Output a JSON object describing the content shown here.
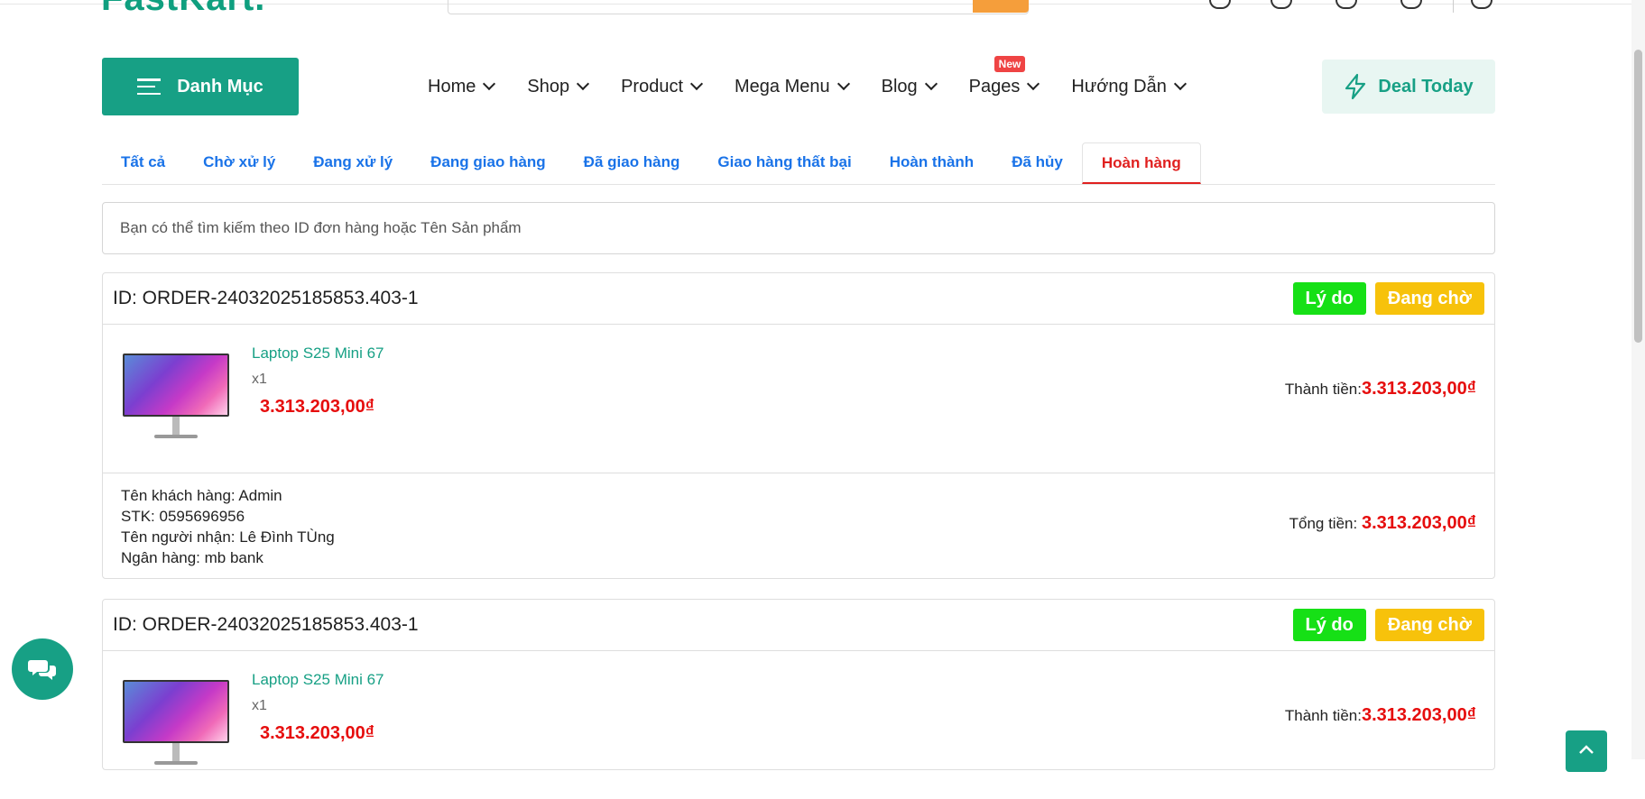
{
  "header": {
    "logo_text": "FastKart.",
    "brand_color": "#17a085"
  },
  "nav": {
    "menu_button": "Danh Mục",
    "items": [
      {
        "label": "Home"
      },
      {
        "label": "Shop"
      },
      {
        "label": "Product"
      },
      {
        "label": "Mega Menu"
      },
      {
        "label": "Blog"
      },
      {
        "label": "Pages",
        "badge": "New"
      },
      {
        "label": "Hướng Dẫn"
      }
    ],
    "deal_label": "Deal Today"
  },
  "tabs": [
    {
      "label": "Tất cả"
    },
    {
      "label": "Chờ xử lý"
    },
    {
      "label": "Đang xử lý"
    },
    {
      "label": "Đang giao hàng"
    },
    {
      "label": "Đã giao hàng"
    },
    {
      "label": "Giao hàng thất bại"
    },
    {
      "label": "Hoàn thành"
    },
    {
      "label": "Đã hủy"
    },
    {
      "label": "Hoàn hàng",
      "active": true
    }
  ],
  "search": {
    "placeholder": "Bạn có thể tìm kiếm theo ID đơn hàng hoặc Tên Sản phẩm"
  },
  "orders": [
    {
      "id_text": "ID: ORDER-24032025185853.403-1",
      "reason_label": "Lý do",
      "status_label": "Đang chờ",
      "product_name": "Laptop S25 Mini 67",
      "quantity": "x1",
      "price": "3.313.203,00₫",
      "subtotal_label": "Thành tiền:",
      "subtotal_value": "3.313.203,00₫",
      "customer": "Tên khách hàng: Admin",
      "account": "STK: 0595696956",
      "recipient": "Tên người nhận: Lê Đình TÙng",
      "bank": "Ngân hàng: mb bank",
      "total_label": "Tổng tiền:",
      "total_value": "3.313.203,00₫"
    },
    {
      "id_text": "ID: ORDER-24032025185853.403-1",
      "reason_label": "Lý do",
      "status_label": "Đang chờ",
      "product_name": "Laptop S25 Mini 67",
      "quantity": "x1",
      "price": "3.313.203,00₫",
      "subtotal_label": "Thành tiền:",
      "subtotal_value": "3.313.203,00₫"
    }
  ]
}
